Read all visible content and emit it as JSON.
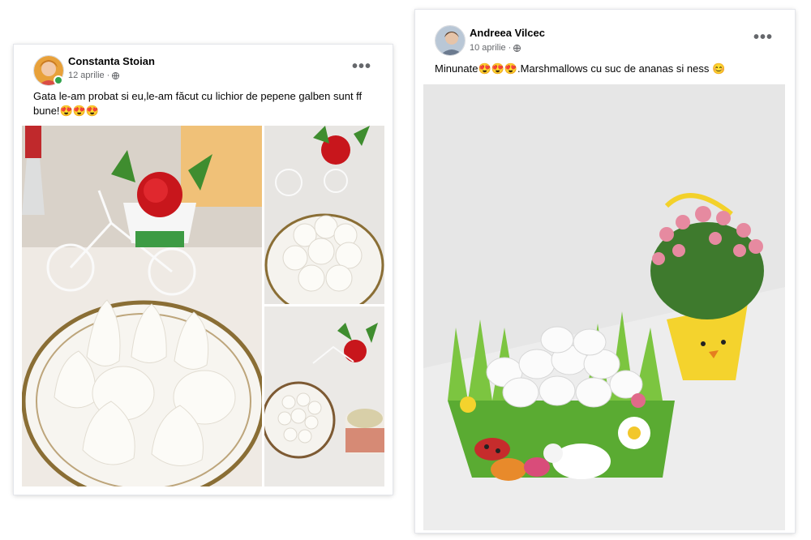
{
  "posts": [
    {
      "author": "Constanta Stoian",
      "date": "12 aprilie",
      "audience_icon": "globe-icon",
      "text_line1": "Gata le-am probat si eu,le-am făcut cu lichior de pepene galben sunt ff",
      "text_line2": "bune!",
      "emoji": [
        "😍",
        "😍",
        "😍"
      ]
    },
    {
      "author": "Andreea Vilcec",
      "date": "10 aprilie",
      "audience_icon": "globe-icon",
      "text_prefix": "Minunate",
      "emoji": [
        "😍",
        "😍",
        "😍"
      ],
      "text_middle": ".Marshmallows cu suc de ananas si ness",
      "emoji_end": "😊"
    }
  ],
  "more_label": "•••",
  "colors": {
    "online": "#31a24c",
    "name": "#050505",
    "meta": "#65676b"
  }
}
